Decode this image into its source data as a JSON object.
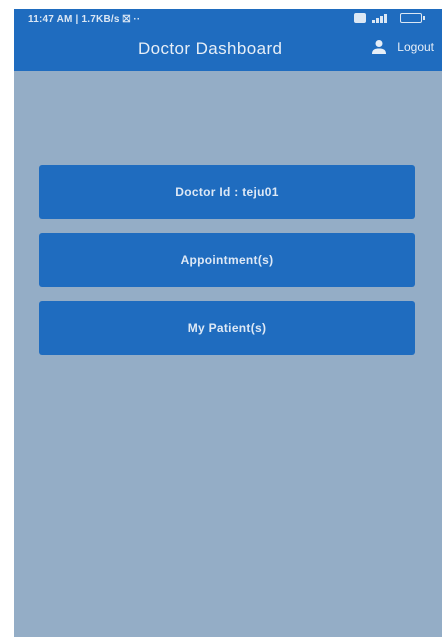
{
  "status_bar": {
    "time_info": "11:47 AM | 1.7KB/s ⛝ ··",
    "icons": [
      "message-icon",
      "signal-icon",
      "battery-icon"
    ],
    "battery": "35"
  },
  "app_bar": {
    "title": "Doctor Dashboard",
    "logout_label": "Logout",
    "logout_icon": "user-icon"
  },
  "menu": {
    "doctor_id_label": "Doctor Id : teju01",
    "appointments_label": "Appointment(s)",
    "patients_label": "My Patient(s)"
  },
  "colors": {
    "primary": "#1f6cbf",
    "background": "#94adc6",
    "text_on_primary": "#dde8f5"
  }
}
